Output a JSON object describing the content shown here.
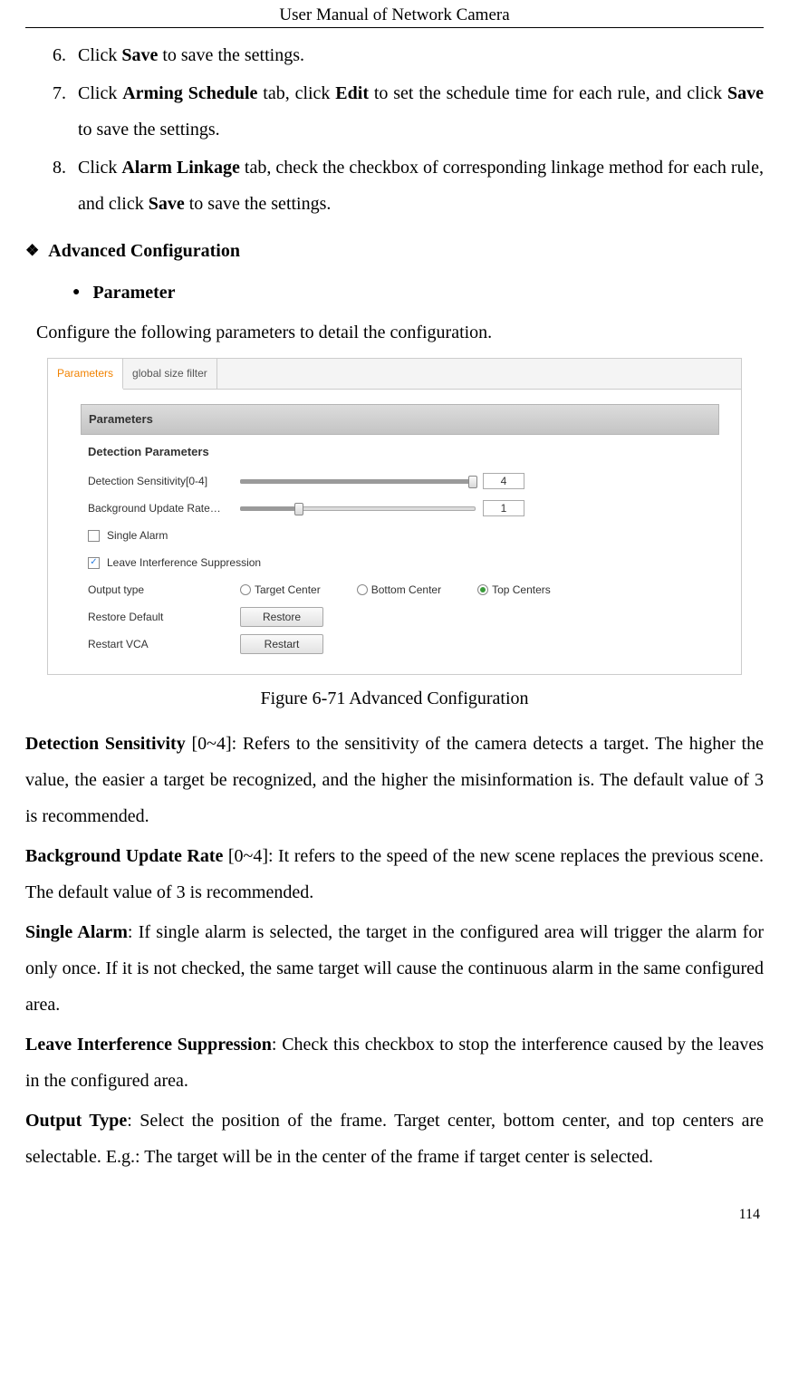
{
  "header": {
    "title": "User Manual of Network Camera"
  },
  "page_number": "114",
  "steps": {
    "start": 6,
    "items": [
      {
        "pre": "Click ",
        "b1": "Save",
        "post": " to save the settings."
      },
      {
        "pre": "Click ",
        "b1": "Arming Schedule",
        "mid1": " tab, click ",
        "b2": "Edit",
        "mid2": " to set the schedule time for each rule, and click ",
        "b3": "Save",
        "post": " to save the settings."
      },
      {
        "pre": "Click ",
        "b1": "Alarm Linkage",
        "mid1": " tab, check the checkbox of corresponding linkage method for each rule, and click ",
        "b2": "Save",
        "post": " to save the settings."
      }
    ]
  },
  "adv_heading": "Advanced Configuration",
  "param_heading": "Parameter",
  "intro": "Configure the following parameters to detail the configuration.",
  "figure": {
    "tabs": {
      "active": "Parameters",
      "other": "global size filter"
    },
    "section_header": "Parameters",
    "sub_header": "Detection Parameters",
    "sensitivity": {
      "label": "Detection Sensitivity[0-4]",
      "value": "4",
      "pct": 100
    },
    "bg_rate": {
      "label": "Background Update Rate…",
      "value": "1",
      "pct": 25
    },
    "single_alarm": {
      "label": "Single Alarm",
      "checked": false
    },
    "leave_sup": {
      "label": "Leave Interference Suppression",
      "checked": true
    },
    "output_type": {
      "label": "Output type",
      "options": [
        {
          "label": "Target Center",
          "selected": false
        },
        {
          "label": "Bottom Center",
          "selected": false
        },
        {
          "label": "Top Centers",
          "selected": true
        }
      ]
    },
    "restore": {
      "label": "Restore Default",
      "button": "Restore"
    },
    "restart": {
      "label": "Restart VCA",
      "button": "Restart"
    }
  },
  "caption": "Figure 6-71 Advanced Configuration",
  "paras": {
    "p1": {
      "b": "Detection Sensitivity",
      "t": " [0~4]: Refers to the sensitivity of the camera detects a target. The higher the value, the easier a target be recognized, and the higher the misinformation is. The default value of 3 is recommended."
    },
    "p2": {
      "b": "Background Update Rate",
      "t": " [0~4]: It refers to the speed of the new scene replaces the previous scene. The default value of 3 is recommended."
    },
    "p3": {
      "b": "Single Alarm",
      "t": ": If single alarm is selected, the target in the configured area will trigger the alarm for only once. If it is not checked, the same target will cause the continuous alarm in the same configured area."
    },
    "p4": {
      "b": "Leave Interference Suppression",
      "t": ": Check this checkbox to stop the interference caused by the leaves in the configured area."
    },
    "p5": {
      "b": "Output Type",
      "t": ": Select the position of the frame. Target center, bottom center, and top centers are selectable. E.g.: The target will be in the center of the frame if target center is selected."
    }
  }
}
